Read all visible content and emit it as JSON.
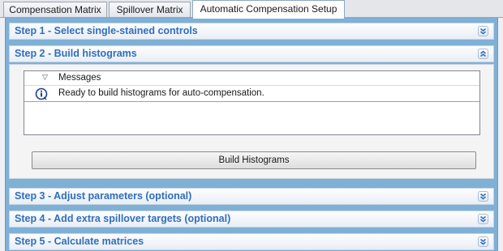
{
  "tabs": [
    {
      "label": "Compensation Matrix",
      "active": false
    },
    {
      "label": "Spillover Matrix",
      "active": false
    },
    {
      "label": "Automatic Compensation Setup",
      "active": true
    }
  ],
  "steps": [
    {
      "title": "Step 1 - Select single-stained controls",
      "expanded": false,
      "toggle_icon": "chevron-double-down-icon"
    },
    {
      "title": "Step 2 - Build histograms",
      "expanded": true,
      "toggle_icon": "chevron-double-up-icon"
    },
    {
      "title": "Step 3 - Adjust parameters (optional)",
      "expanded": false,
      "toggle_icon": "chevron-double-down-icon"
    },
    {
      "title": "Step 4 - Add extra spillover targets (optional)",
      "expanded": false,
      "toggle_icon": "chevron-double-down-icon"
    },
    {
      "title": "Step 5 - Calculate matrices",
      "expanded": false,
      "toggle_icon": "chevron-double-down-icon"
    }
  ],
  "messages": {
    "column_header": "Messages",
    "rows": [
      {
        "icon": "info-icon",
        "text": "Ready to build histograms for auto-compensation."
      }
    ]
  },
  "build_button": {
    "label": "Build Histograms"
  },
  "colors": {
    "step_title": "#2f6fbd",
    "panel_background": "#7fb0d6"
  }
}
